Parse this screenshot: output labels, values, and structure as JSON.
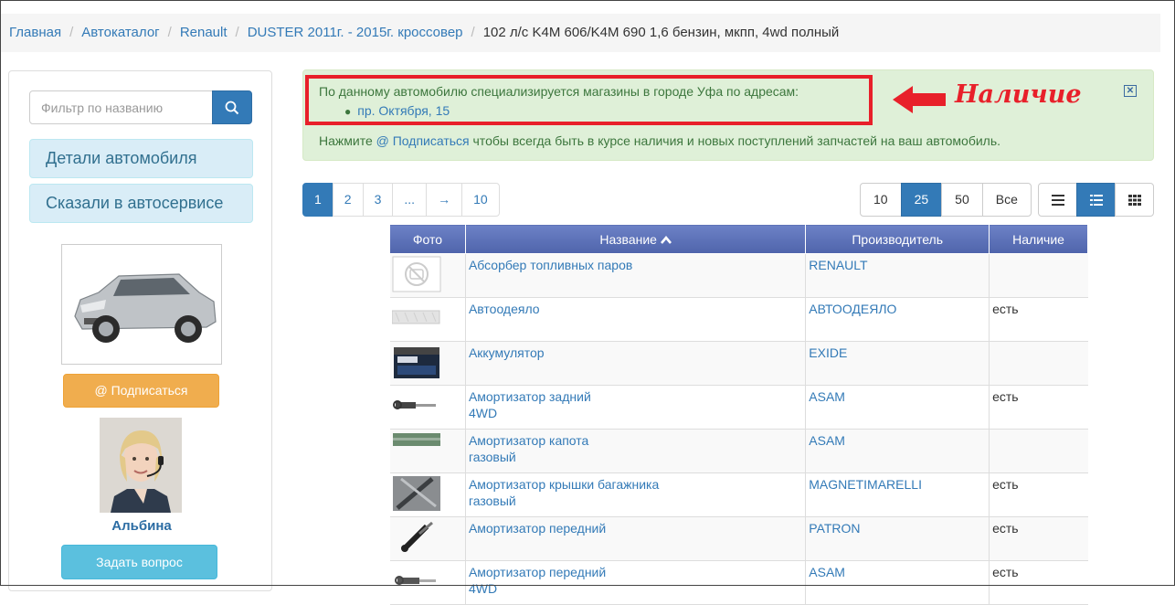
{
  "breadcrumb": {
    "items": [
      "Главная",
      "Автокаталог",
      "Renault",
      "DUSTER 2011г. - 2015г. кроссовер"
    ],
    "current": "102 л/с K4M 606/K4M 690 1,6 бензин, мкпп, 4wd полный",
    "separator": "/"
  },
  "sidebar": {
    "search_placeholder": "Фильтр по названию",
    "search_icon": "search-icon",
    "items": [
      {
        "label": "Детали автомобиля"
      },
      {
        "label": "Сказали в автосервисе"
      }
    ],
    "subscribe_label": "@ Подписаться",
    "manager_name": "Альбина",
    "ask_label": "Задать вопрос"
  },
  "alert": {
    "text": "По данному автомобилю специализируется магазины в городе Уфа по адресам:",
    "address": "пр. Октября, 15",
    "line2_link": "@ Подписаться",
    "line2_text": " чтобы всегда быть в курсе наличия и новых поступлений запчастей на ваш автомобиль.",
    "line2_prefix": "Нажмите ",
    "annotation": "Наличие",
    "close_icon": "close-icon"
  },
  "pagination": {
    "pages": [
      "1",
      "2",
      "3",
      "...",
      "→",
      "10"
    ],
    "active": "1"
  },
  "page_size": {
    "options": [
      "10",
      "25",
      "50",
      "Все"
    ],
    "selected": "25"
  },
  "view_modes": [
    "list-icon",
    "detailed-list-icon",
    "grid-icon"
  ],
  "table": {
    "headers": {
      "photo": "Фото",
      "name": "Название",
      "manufacturer": "Производитель",
      "availability": "Наличие"
    },
    "sort_icon": "chevron-up-icon",
    "rows": [
      {
        "name": "Абсорбер топливных паров",
        "sub": "",
        "manufacturer": "RENAULT",
        "availability": "",
        "photo": "no-photo-icon"
      },
      {
        "name": "Автоодеяло",
        "sub": "",
        "manufacturer": "АВТООДЕЯЛО",
        "availability": "есть",
        "photo": "car-blanket-photo"
      },
      {
        "name": "Аккумулятор",
        "sub": "",
        "manufacturer": "EXIDE",
        "availability": "",
        "photo": "battery-photo"
      },
      {
        "name": "Амортизатор задний",
        "sub": "4WD",
        "manufacturer": "ASAM",
        "availability": "есть",
        "photo": "shock-absorber-photo"
      },
      {
        "name": "Амортизатор капота",
        "sub": "газовый",
        "manufacturer": "ASAM",
        "availability": "",
        "photo": "gas-strut-photo"
      },
      {
        "name": "Амортизатор крышки багажника",
        "sub": "газовый",
        "manufacturer": "MAGNETIMARELLI",
        "availability": "есть",
        "photo": "trunk-strut-photo"
      },
      {
        "name": "Амортизатор передний",
        "sub": "",
        "manufacturer": "PATRON",
        "availability": "есть",
        "photo": "front-shock-photo"
      },
      {
        "name": "Амортизатор передний",
        "sub": "4WD",
        "manufacturer": "ASAM",
        "availability": "есть",
        "photo": "front-shock-photo"
      }
    ]
  }
}
